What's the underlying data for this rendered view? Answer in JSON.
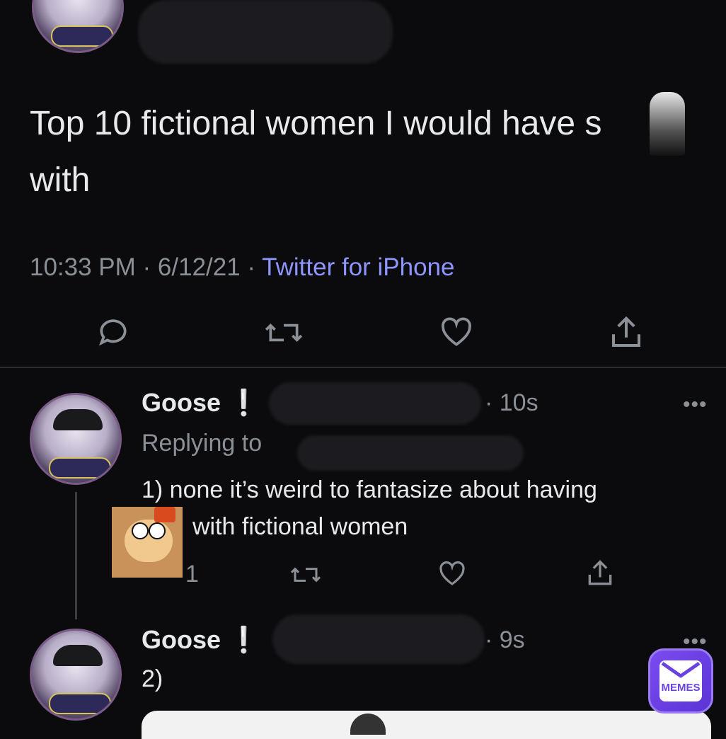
{
  "tweet": {
    "text": "Top 10 fictional women I would have s with",
    "time": "10:33 PM · 6/12/21 · ",
    "source": "Twitter for iPhone"
  },
  "reply1": {
    "name": "Goose ❕",
    "time": "· 10s",
    "replying_to": "Replying to",
    "text_line1": "1) none it’s weird to fantasize about having",
    "text_line2": "with fictional women",
    "reply_count": "1",
    "more": "•••"
  },
  "reply2": {
    "name": "Goose ❕",
    "time": "· 9s",
    "text": "2)",
    "more": "•••"
  },
  "watermark": {
    "label": "MEMES"
  },
  "colors": {
    "background": "#0b0b0d",
    "link": "#8f95ff",
    "muted": "#8b8f96",
    "brand": "#6a42e0"
  }
}
